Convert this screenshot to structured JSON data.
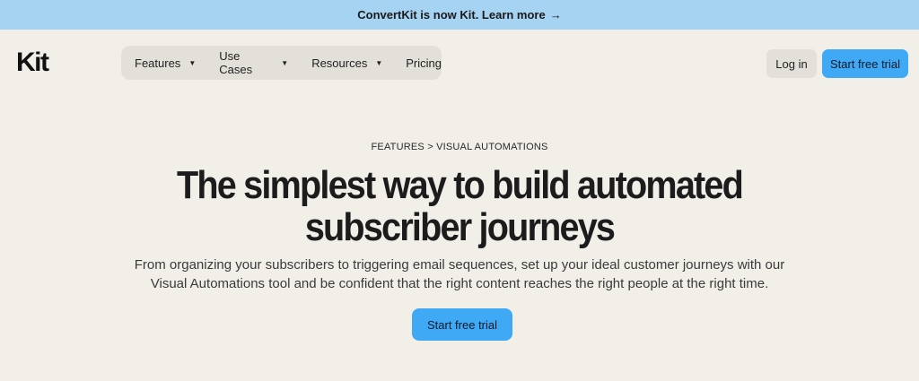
{
  "banner": {
    "text": "ConvertKit is now Kit. Learn more",
    "arrow": "→"
  },
  "header": {
    "logo": "Kit",
    "menu": [
      {
        "label": "Features",
        "has_dropdown": true
      },
      {
        "label": "Use Cases",
        "has_dropdown": true
      },
      {
        "label": "Resources",
        "has_dropdown": true
      },
      {
        "label": "Pricing",
        "has_dropdown": false
      }
    ],
    "caret": "▼",
    "login_label": "Log in",
    "cta_label": "Start free trial"
  },
  "hero": {
    "breadcrumb": "FEATURES > VISUAL AUTOMATIONS",
    "headline_line1": "The simplest way to build automated",
    "headline_line2": "subscriber journeys",
    "sub_line1": "From organizing your subscribers to triggering email sequences, set up your ideal customer journeys with our",
    "sub_line2": "Visual Automations tool and be confident that the right content reaches the right people at the right time.",
    "cta_label": "Start free trial"
  },
  "colors": {
    "banner": "#a6d3f2",
    "background": "#f2efe9",
    "accent": "#3fa9f5",
    "pill": "#e3e0da"
  }
}
